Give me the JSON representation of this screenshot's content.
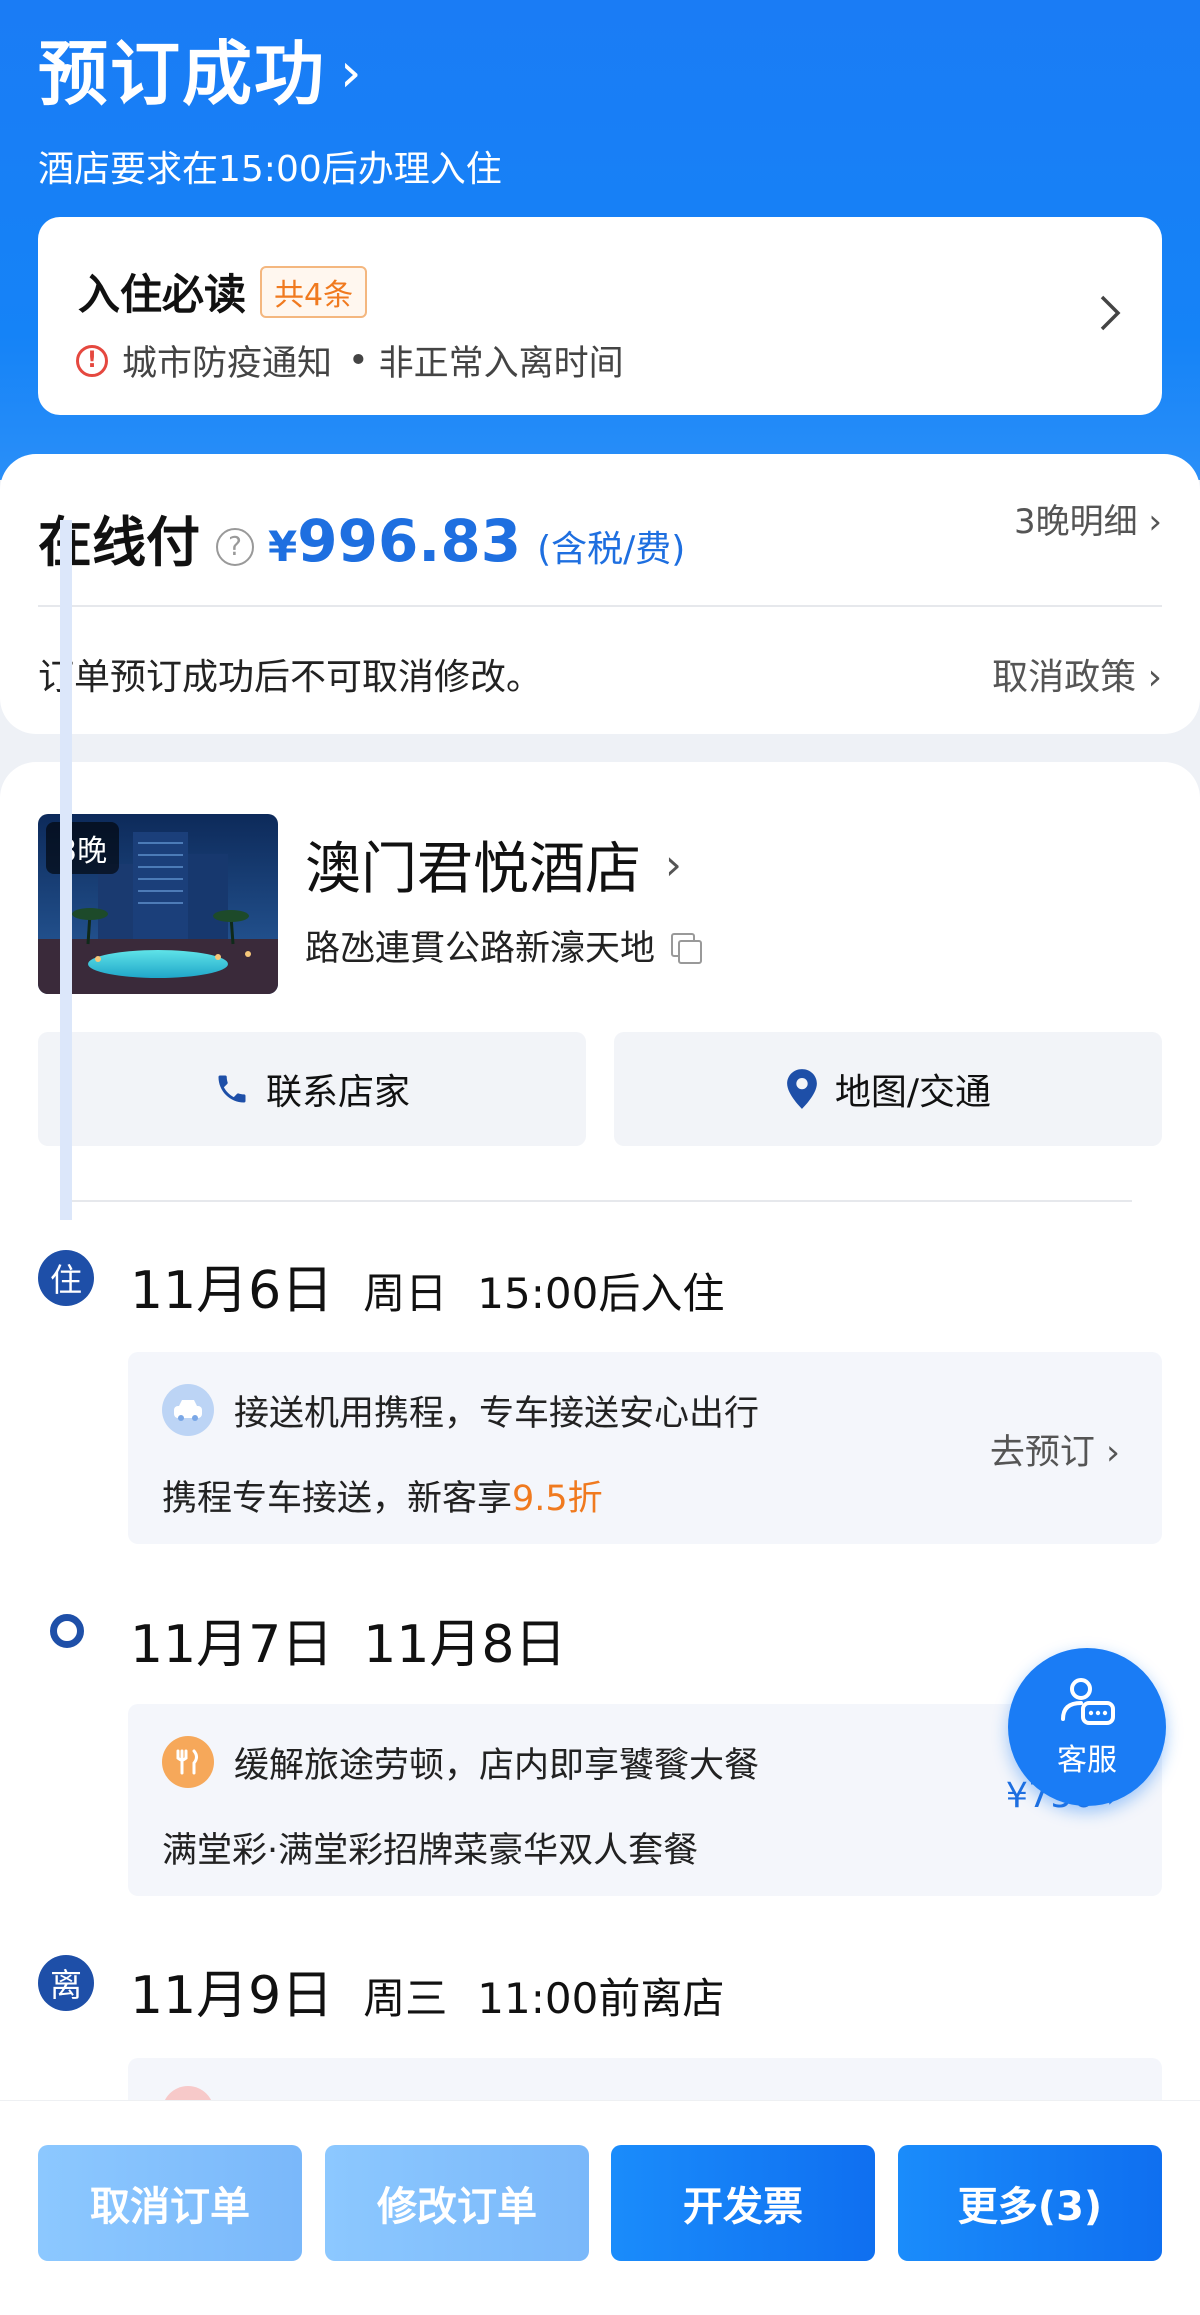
{
  "header": {
    "title": "预订成功",
    "chevron": "›",
    "checkin_notice": "酒店要求在15:00后办理入住"
  },
  "notice_card": {
    "title": "入住必读",
    "count_badge": "共4条",
    "items": [
      "城市防疫通知",
      "非正常入离时间"
    ],
    "separator": "•",
    "warn_glyph": "!"
  },
  "payment": {
    "label": "在线付",
    "help_glyph": "?",
    "currency": "¥",
    "amount": "996.83",
    "tax_note": "(含税/费)",
    "detail_link": "3晚明细 ›",
    "cancel_note": "订单预订成功后不可取消修改。",
    "policy_link": "取消政策 ›"
  },
  "hotel": {
    "nights_tag": "3晚",
    "name": "澳门君悦酒店",
    "chevron": "›",
    "address": "路氹連貫公路新濠天地",
    "contact_button": "联系店家",
    "map_button": "地图/交通"
  },
  "timeline": [
    {
      "badge": "住",
      "date": "11月6日",
      "weekday": "周日",
      "time": "15:00后入住"
    },
    {
      "date": "11月7日",
      "weekday": "11月8日"
    },
    {
      "badge": "离",
      "date": "11月9日",
      "weekday": "周三",
      "time": "11:00前离店"
    }
  ],
  "promos": {
    "transfer": {
      "title": "接送机用携程，专车接送安心出行",
      "sub_prefix": "携程专车接送，新客享",
      "sub_highlight": "9.5折",
      "action": "去预订 ›"
    },
    "dining": {
      "title": "缓解旅途劳顿，店内即享饕餮大餐",
      "sub": "满堂彩·满堂彩招牌菜豪华双人套餐",
      "price": "¥750 ›"
    }
  },
  "fab": {
    "label": "客服"
  },
  "bottom_bar": {
    "cancel_order": "取消订单",
    "modify_order": "修改订单",
    "invoice": "开发票",
    "more": "更多(3)"
  },
  "colors": {
    "brand_blue": "#1a7cf5",
    "accent_orange": "#f07a1f",
    "price_blue": "#1e6fe0",
    "timeline_navy": "#1e4fa8"
  }
}
